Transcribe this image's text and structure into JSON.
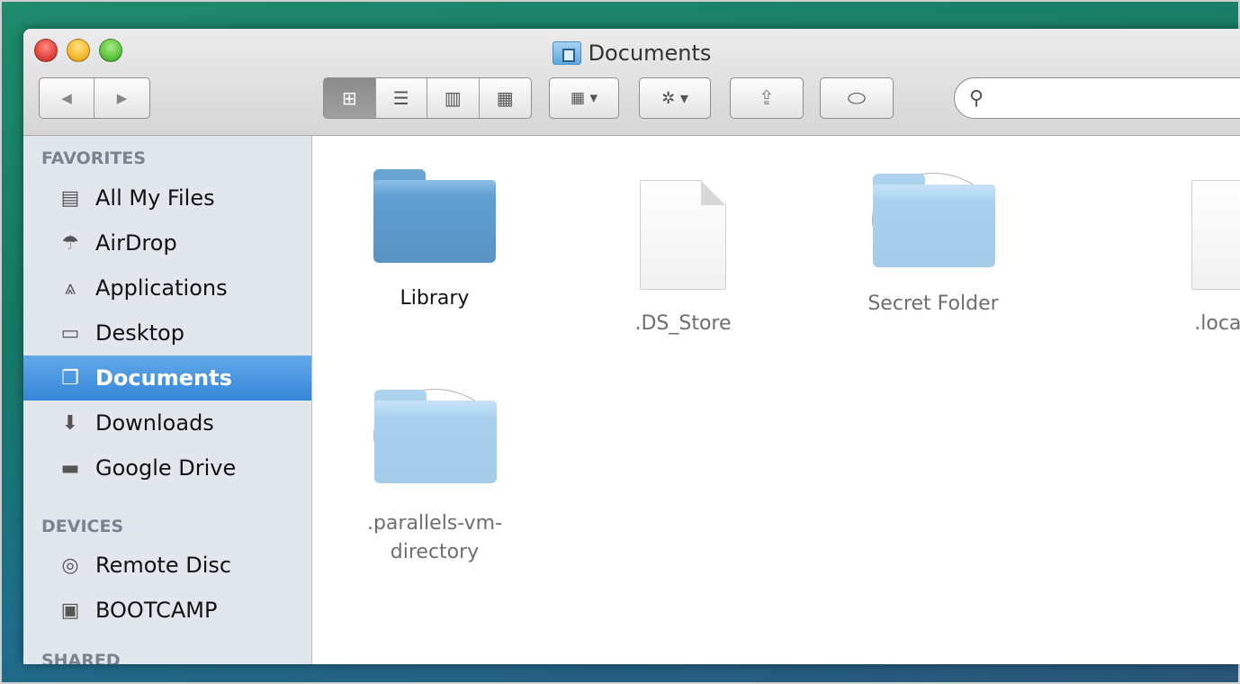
{
  "window": {
    "title": "Documents"
  },
  "toolbar": {
    "back_glyph": "◀",
    "forward_glyph": "▶",
    "view_icon_glyph": "⊞",
    "view_list_glyph": "☰",
    "view_column_glyph": "▥",
    "view_coverflow_glyph": "▦",
    "arrange_glyph": "▦ ▾",
    "action_glyph": "✲ ▾",
    "share_glyph": "⇪",
    "tags_glyph": "⬭",
    "search_glyph": "⚲",
    "search_value": "",
    "search_placeholder": ""
  },
  "sidebar": {
    "favorites_label": "FAVORITES",
    "devices_label": "DEVICES",
    "shared_label": "SHARED",
    "favorites": [
      {
        "label": "All My Files",
        "icon": "all-files-icon",
        "glyph": "▤"
      },
      {
        "label": "AirDrop",
        "icon": "airdrop-icon",
        "glyph": "☂"
      },
      {
        "label": "Applications",
        "icon": "applications-icon",
        "glyph": "⩓"
      },
      {
        "label": "Desktop",
        "icon": "desktop-icon",
        "glyph": "▭"
      },
      {
        "label": "Documents",
        "icon": "documents-icon",
        "glyph": "❐"
      },
      {
        "label": "Downloads",
        "icon": "downloads-icon",
        "glyph": "⬇"
      },
      {
        "label": "Google Drive",
        "icon": "folder-icon",
        "glyph": "▬"
      }
    ],
    "devices": [
      {
        "label": "Remote Disc",
        "icon": "disc-icon",
        "glyph": "◎"
      },
      {
        "label": "BOOTCAMP",
        "icon": "drive-icon",
        "glyph": "▣"
      }
    ],
    "selected": "Documents"
  },
  "files": [
    {
      "name": "Library",
      "kind": "folder"
    },
    {
      "name": ".DS_Store",
      "kind": "document"
    },
    {
      "name": "Secret Folder",
      "kind": "folder-hidden"
    },
    {
      "name": ".localize",
      "kind": "document"
    },
    {
      "name": ".parallels-vm-",
      "name_line2": "directory",
      "kind": "folder-hidden"
    }
  ],
  "colors": {
    "selection": "#3586d8",
    "sidebar_bg": "#e2e7ed",
    "section_heading": "#7a8490"
  }
}
